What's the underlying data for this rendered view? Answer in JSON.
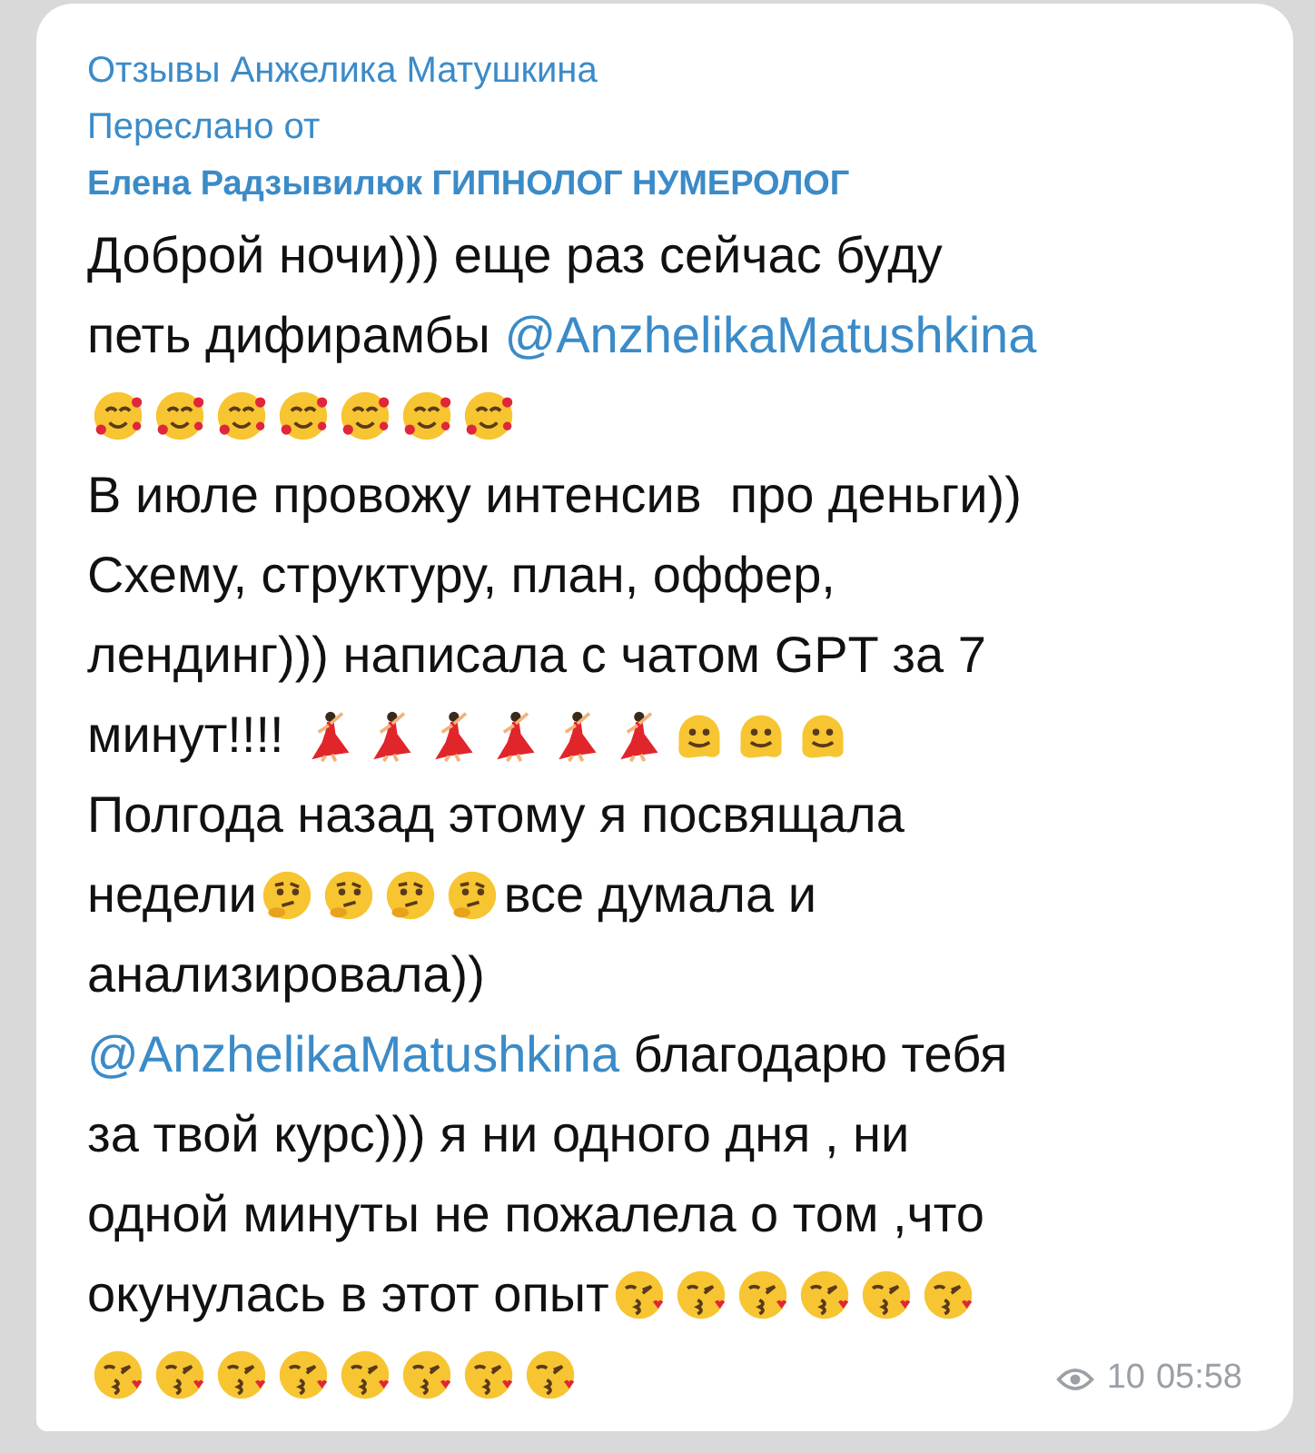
{
  "header": {
    "channel": "Отзывы Анжелика Матушкина",
    "forwarded_label": "Переслано от",
    "forwarded_from": "Елена Радзывилюк ГИПНОЛОГ НУМЕРОЛОГ"
  },
  "message": {
    "lines": [
      [
        {
          "kind": "text",
          "text": "Доброй ночи))) еще раз сейчас буду"
        }
      ],
      [
        {
          "kind": "text",
          "text": "петь дифирамбы "
        },
        {
          "kind": "mention",
          "text": "@AnzhelikaMatushkina"
        }
      ],
      [
        {
          "kind": "hearts"
        },
        {
          "kind": "hearts"
        },
        {
          "kind": "hearts"
        },
        {
          "kind": "hearts"
        },
        {
          "kind": "hearts"
        },
        {
          "kind": "hearts"
        },
        {
          "kind": "hearts"
        }
      ],
      [
        {
          "kind": "text",
          "text": "В июле провожу интенсив  про деньги))"
        }
      ],
      [
        {
          "kind": "text",
          "text": "Схему, структуру, план, оффер,"
        }
      ],
      [
        {
          "kind": "text",
          "text": "лендинг))) написала с чатом GPT за 7"
        }
      ],
      [
        {
          "kind": "text",
          "text": "минут!!!! "
        },
        {
          "kind": "dancer"
        },
        {
          "kind": "dancer"
        },
        {
          "kind": "dancer"
        },
        {
          "kind": "dancer"
        },
        {
          "kind": "dancer"
        },
        {
          "kind": "dancer"
        },
        {
          "kind": "melting"
        },
        {
          "kind": "melting"
        },
        {
          "kind": "melting"
        }
      ],
      [
        {
          "kind": "text",
          "text": "Полгода назад этому я посвящала"
        }
      ],
      [
        {
          "kind": "text",
          "text": "недели"
        },
        {
          "kind": "thinking"
        },
        {
          "kind": "thinking"
        },
        {
          "kind": "thinking"
        },
        {
          "kind": "thinking"
        },
        {
          "kind": "text",
          "text": "все думала и"
        }
      ],
      [
        {
          "kind": "text",
          "text": "анализировала))"
        }
      ],
      [
        {
          "kind": "mention",
          "text": "@AnzhelikaMatushkina"
        },
        {
          "kind": "text",
          "text": " благодарю тебя"
        }
      ],
      [
        {
          "kind": "text",
          "text": "за твой курс))) я ни одного дня , ни"
        }
      ],
      [
        {
          "kind": "text",
          "text": "одной минуты не пожалела о том ,что"
        }
      ],
      [
        {
          "kind": "text",
          "text": "окунулась в этот опыт"
        },
        {
          "kind": "kiss"
        },
        {
          "kind": "kiss"
        },
        {
          "kind": "kiss"
        },
        {
          "kind": "kiss"
        },
        {
          "kind": "kiss"
        },
        {
          "kind": "kiss"
        }
      ],
      [
        {
          "kind": "kiss"
        },
        {
          "kind": "kiss"
        },
        {
          "kind": "kiss"
        },
        {
          "kind": "kiss"
        },
        {
          "kind": "kiss"
        },
        {
          "kind": "kiss"
        },
        {
          "kind": "kiss"
        },
        {
          "kind": "kiss"
        }
      ]
    ]
  },
  "meta": {
    "views": "10",
    "time": "05:58"
  }
}
